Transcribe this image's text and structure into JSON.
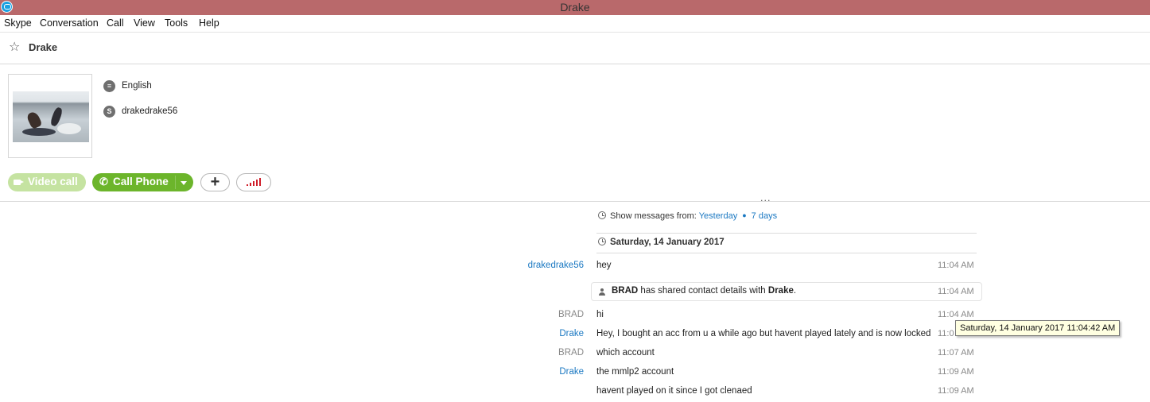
{
  "window": {
    "title": "Drake"
  },
  "menu": [
    "Skype",
    "Conversation",
    "Call",
    "View",
    "Tools",
    "Help"
  ],
  "contact": {
    "name": "Drake",
    "language": "English",
    "skype_name": "drakedrake56"
  },
  "actions": {
    "video_call": "Video call",
    "call_phone": "Call Phone",
    "add": "+",
    "more_dots": "..."
  },
  "history": {
    "show_from_label": "Show messages from:",
    "yesterday": "Yesterday",
    "seven_days": "7 days"
  },
  "date_header": "Saturday, 14 January 2017",
  "messages": [
    {
      "sender": "drakedrake56",
      "text": "hey",
      "time": "11:04 AM"
    },
    {
      "sender": "BRAD",
      "text": "hi",
      "time": "11:04 AM"
    },
    {
      "sender": "Drake",
      "text": "Hey, I bought an acc from u a while ago but havent played lately and is now locked",
      "time": "11:0"
    },
    {
      "sender": "BRAD",
      "text": "which account",
      "time": "11:07 AM"
    },
    {
      "sender": "Drake",
      "text": "the mmlp2 account",
      "time": "11:09 AM"
    },
    {
      "sender": "",
      "text": "havent played on it since I got clenaed",
      "time": "11:09 AM"
    }
  ],
  "shared_notice": {
    "actor": "BRAD",
    "middle": " has shared contact details with ",
    "target": "Drake",
    "end": ".",
    "time": "11:04 AM"
  },
  "tooltip": "Saturday, 14 January 2017 11:04:42 AM",
  "colors": {
    "titlebar": "#b9696b",
    "accent_green": "#6cb52b",
    "link_blue": "#1a78c2",
    "signal_red": "#d01e2a"
  }
}
